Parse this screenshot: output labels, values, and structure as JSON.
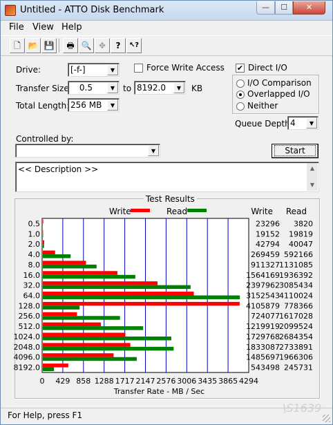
{
  "window": {
    "title": "Untitled - ATTO Disk Benchmark",
    "minimize_glyph": "—",
    "maximize_glyph": "☐",
    "close_glyph": "✕"
  },
  "menu": {
    "file": "File",
    "view": "View",
    "help": "Help"
  },
  "toolbar": {
    "buttons": [
      {
        "icon": "new-file-icon",
        "glyph": "🗋"
      },
      {
        "icon": "open-folder-icon",
        "glyph": "📂"
      },
      {
        "icon": "save-icon",
        "glyph": "💾"
      },
      {
        "icon": "print-icon",
        "glyph": "🖶"
      },
      {
        "icon": "print-preview-icon",
        "glyph": "🔍"
      },
      {
        "icon": "move-icon",
        "glyph": "✥"
      },
      {
        "icon": "about-icon",
        "glyph": "?"
      },
      {
        "icon": "context-help-icon",
        "glyph": "↖?"
      }
    ]
  },
  "settings": {
    "drive_label": "Drive:",
    "drive_value": "[-f-]",
    "force_write_label": "Force Write Access",
    "force_write_checked": false,
    "direct_io_label": "Direct I/O",
    "direct_io_checked": true,
    "transfer_size_label": "Transfer Size:",
    "transfer_size_from": "0.5",
    "to_label": "to",
    "transfer_size_to": "8192.0",
    "kb_label": "KB",
    "total_length_label": "Total Length:",
    "total_length_value": "256 MB",
    "io_modes": [
      {
        "label": "I/O Comparison",
        "selected": false
      },
      {
        "label": "Overlapped I/O",
        "selected": true
      },
      {
        "label": "Neither",
        "selected": false
      }
    ],
    "queue_depth_label": "Queue Depth:",
    "queue_depth_value": "4",
    "controlled_by_label": "Controlled by:",
    "controlled_by_value": "",
    "start_label": "Start",
    "description_text": "<< Description >>"
  },
  "chart_data": {
    "type": "bar",
    "title": "Test Results",
    "xlabel": "Transfer Rate - MB / Sec",
    "ylabel": "",
    "xlim": [
      0,
      4294
    ],
    "x_ticks": [
      "0",
      "429",
      "858",
      "1288",
      "1717",
      "2147",
      "2576",
      "3006",
      "3435",
      "3865",
      "4294"
    ],
    "categories": [
      "0.5",
      "1.0",
      "2.0",
      "4.0",
      "8.0",
      "16.0",
      "32.0",
      "64.0",
      "128.0",
      "256.0",
      "512.0",
      "1024.0",
      "2048.0",
      "4096.0",
      "8192.0"
    ],
    "legend_placement": "top",
    "column_headers": {
      "write": "Write",
      "read": "Read"
    },
    "series": [
      {
        "name": "Write",
        "color": "#ff0000",
        "values": [
          23296,
          19152,
          42794,
          269459,
          911327,
          1564169,
          2397962,
          3152543,
          4105879,
          724077,
          1219919,
          1729768,
          1833087,
          1485697,
          543498
        ]
      },
      {
        "name": "Read",
        "color": "#008000",
        "values": [
          3820,
          19819,
          40047,
          592166,
          1131085,
          1936392,
          3085434,
          4110024,
          778366,
          1617028,
          2099524,
          2684354,
          2733891,
          1966306,
          245731
        ]
      }
    ],
    "grid": true
  },
  "status": {
    "text": "For Help, press F1",
    "watermark": "\\S1639"
  }
}
